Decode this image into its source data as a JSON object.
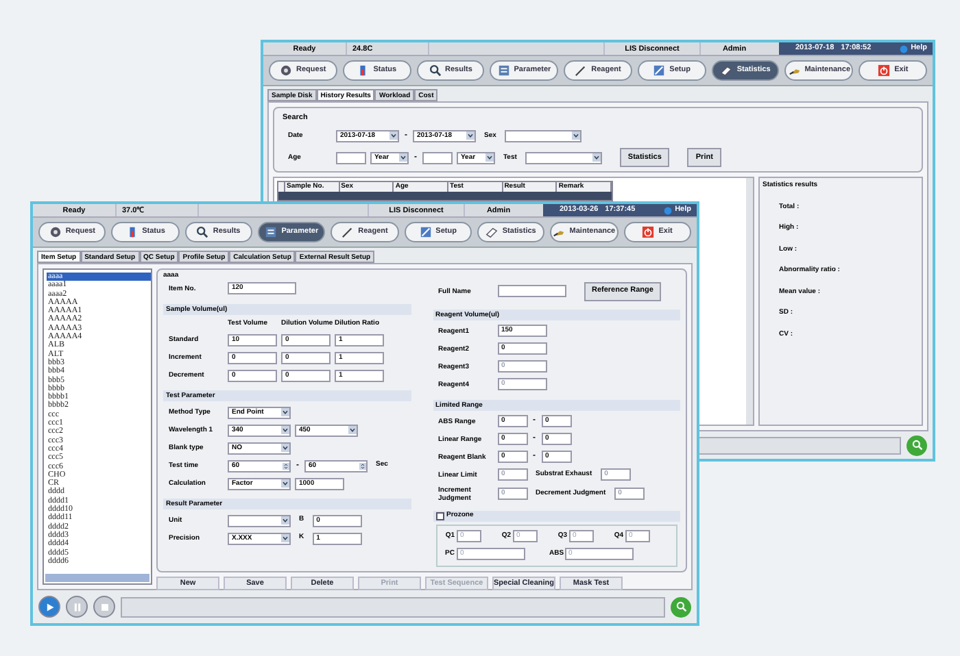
{
  "back_window": {
    "status_bar": {
      "state": "Ready",
      "temperature": "24.8C",
      "lis": "LIS Disconnect",
      "user": "Admin",
      "date": "2013-07-18",
      "time": "17:08:52",
      "help": "Help"
    },
    "toolbar": [
      {
        "label": "Request",
        "selected": false
      },
      {
        "label": "Status",
        "selected": false
      },
      {
        "label": "Results",
        "selected": false
      },
      {
        "label": "Parameter",
        "selected": false
      },
      {
        "label": "Reagent",
        "selected": false
      },
      {
        "label": "Setup",
        "selected": false
      },
      {
        "label": "Statistics",
        "selected": true
      },
      {
        "label": "Maintenance",
        "selected": false
      },
      {
        "label": "Exit",
        "selected": false
      }
    ],
    "tabs": [
      {
        "label": "Sample Disk",
        "selected": false
      },
      {
        "label": "History Results",
        "selected": true
      },
      {
        "label": "Workload",
        "selected": false
      },
      {
        "label": "Cost",
        "selected": false
      }
    ],
    "search": {
      "title": "Search",
      "rows": [
        {
          "label": "Date",
          "controls": [
            {
              "kind": "select",
              "value": "2013-07-18"
            },
            {
              "kind": "text",
              "value": "-"
            },
            {
              "kind": "select",
              "value": "2013-07-18"
            },
            {
              "kind": "label",
              "value": "Sex"
            },
            {
              "kind": "select_l"
            }
          ]
        },
        {
          "label": "Age",
          "controls": [
            {
              "kind": "input_s"
            },
            {
              "kind": "select_s",
              "value": "Year"
            },
            {
              "kind": "text",
              "value": "-"
            },
            {
              "kind": "input_s"
            },
            {
              "kind": "select_s",
              "value": "Year"
            },
            {
              "kind": "label",
              "value": "Test"
            },
            {
              "kind": "select_l"
            },
            {
              "kind": "button",
              "value": "Statistics"
            },
            {
              "kind": "button",
              "value": "Print"
            }
          ]
        }
      ]
    },
    "table": {
      "columns": [
        "Sample No.",
        "Sex",
        "Age",
        "Test",
        "Result",
        "Remark"
      ],
      "rows": [
        {
          "selected": true
        }
      ]
    },
    "statistics_results": {
      "title": "Statistics results",
      "items": [
        "Total :",
        "High :",
        "Low :",
        "Abnormality ratio :",
        "Mean value :",
        "SD :",
        "CV :"
      ]
    }
  },
  "front_window": {
    "status_bar": {
      "state": "Ready",
      "temperature": "37.0℃",
      "lis": "LIS Disconnect",
      "user": "Admin",
      "date": "2013-03-26",
      "time": "17:37:45",
      "help": "Help"
    },
    "toolbar": [
      {
        "label": "Request",
        "selected": false
      },
      {
        "label": "Status",
        "selected": false
      },
      {
        "label": "Results",
        "selected": false
      },
      {
        "label": "Parameter",
        "selected": true
      },
      {
        "label": "Reagent",
        "selected": false
      },
      {
        "label": "Setup",
        "selected": false
      },
      {
        "label": "Statistics",
        "selected": false
      },
      {
        "label": "Maintenance",
        "selected": false
      },
      {
        "label": "Exit",
        "selected": false
      }
    ],
    "tabs": [
      {
        "label": "Item Setup",
        "selected": true
      },
      {
        "label": "Standard Setup",
        "selected": false
      },
      {
        "label": "QC Setup",
        "selected": false
      },
      {
        "label": "Profile Setup",
        "selected": false
      },
      {
        "label": "Calculation Setup",
        "selected": false
      },
      {
        "label": "External Result Setup",
        "selected": false
      }
    ],
    "item_list": [
      {
        "label": "aaaa",
        "selected": true
      },
      {
        "label": "aaaa1",
        "selected": false
      },
      {
        "label": "aaaa2",
        "selected": false
      },
      {
        "label": "AAAAA",
        "selected": false
      },
      {
        "label": "AAAAA1",
        "selected": false
      },
      {
        "label": "AAAAA2",
        "selected": false
      },
      {
        "label": "AAAAA3",
        "selected": false
      },
      {
        "label": "AAAAA4",
        "selected": false
      },
      {
        "label": "ALB",
        "selected": false
      },
      {
        "label": "ALT",
        "selected": false
      },
      {
        "label": "bbb3",
        "selected": false
      },
      {
        "label": "bbb4",
        "selected": false
      },
      {
        "label": "bbb5",
        "selected": false
      },
      {
        "label": "bbbb",
        "selected": false
      },
      {
        "label": "bbbb1",
        "selected": false
      },
      {
        "label": "bbbb2",
        "selected": false
      },
      {
        "label": "ccc",
        "selected": false
      },
      {
        "label": "ccc1",
        "selected": false
      },
      {
        "label": "ccc2",
        "selected": false
      },
      {
        "label": "ccc3",
        "selected": false
      },
      {
        "label": "ccc4",
        "selected": false
      },
      {
        "label": "ccc5",
        "selected": false
      },
      {
        "label": "ccc6",
        "selected": false
      },
      {
        "label": "CHO",
        "selected": false
      },
      {
        "label": "CR",
        "selected": false
      },
      {
        "label": "dddd",
        "selected": false
      },
      {
        "label": "dddd1",
        "selected": false
      },
      {
        "label": "dddd10",
        "selected": false
      },
      {
        "label": "dddd11",
        "selected": false
      },
      {
        "label": "dddd2",
        "selected": false
      },
      {
        "label": "dddd3",
        "selected": false
      },
      {
        "label": "dddd4",
        "selected": false
      },
      {
        "label": "dddd5",
        "selected": false
      },
      {
        "label": "dddd6",
        "selected": false
      }
    ],
    "form": {
      "title": "aaaa",
      "left": [
        {
          "kind": "row",
          "label": "Item No.",
          "controls": [
            {
              "kind": "input_l",
              "value": "120"
            }
          ]
        },
        {
          "kind": "section",
          "title": "Sample Volume(ul)"
        },
        {
          "kind": "heads",
          "heads": [
            "Test Volume",
            "Dilution Volume",
            "Dilution Ratio"
          ]
        },
        {
          "kind": "row",
          "label": "Standard",
          "controls": [
            {
              "kind": "input",
              "value": "10"
            },
            {
              "kind": "input",
              "value": "0"
            },
            {
              "kind": "input",
              "value": "1"
            }
          ]
        },
        {
          "kind": "row",
          "label": "Increment",
          "controls": [
            {
              "kind": "input",
              "value": "0"
            },
            {
              "kind": "input",
              "value": "0"
            },
            {
              "kind": "input",
              "value": "1"
            }
          ]
        },
        {
          "kind": "row",
          "label": "Decrement",
          "controls": [
            {
              "kind": "input",
              "value": "0"
            },
            {
              "kind": "input",
              "value": "0"
            },
            {
              "kind": "input",
              "value": "1"
            }
          ]
        },
        {
          "kind": "section",
          "title": "Test Parameter"
        },
        {
          "kind": "row",
          "label": "Method Type",
          "controls": [
            {
              "kind": "select",
              "value": "End Point"
            }
          ]
        },
        {
          "kind": "row",
          "label": "Wavelength 1",
          "controls": [
            {
              "kind": "select",
              "value": "340"
            },
            {
              "kind": "select",
              "value": "450"
            }
          ]
        },
        {
          "kind": "row",
          "label": "Blank type",
          "controls": [
            {
              "kind": "select",
              "value": "NO"
            }
          ]
        },
        {
          "kind": "row",
          "label": "Test time",
          "controls": [
            {
              "kind": "spin",
              "value": "60"
            },
            {
              "kind": "text",
              "value": "-"
            },
            {
              "kind": "spin",
              "value": "60"
            },
            {
              "kind": "label",
              "value": "Sec"
            }
          ]
        },
        {
          "kind": "row",
          "label": "Calculation",
          "controls": [
            {
              "kind": "select",
              "value": "Factor"
            },
            {
              "kind": "input",
              "value": "1000"
            }
          ]
        },
        {
          "kind": "section",
          "title": "Result Parameter"
        },
        {
          "kind": "row",
          "label": "Unit",
          "controls": [
            {
              "kind": "select"
            },
            {
              "kind": "label",
              "value": "B"
            },
            {
              "kind": "input",
              "value": "0"
            }
          ]
        },
        {
          "kind": "row",
          "label": "Precision",
          "controls": [
            {
              "kind": "select",
              "value": "X.XXX"
            },
            {
              "kind": "label",
              "value": "K"
            },
            {
              "kind": "input",
              "value": "1"
            }
          ]
        }
      ],
      "right": [
        {
          "kind": "row",
          "label": "Full Name",
          "controls": [
            {
              "kind": "input_l"
            },
            {
              "kind": "button",
              "value": "Reference Range"
            }
          ]
        },
        {
          "kind": "section",
          "title": "Reagent Volume(ul)"
        },
        {
          "kind": "row",
          "label": "Reagent1",
          "controls": [
            {
              "kind": "input",
              "value": "150",
              "disabled": false
            }
          ]
        },
        {
          "kind": "row",
          "label": "Reagent2",
          "controls": [
            {
              "kind": "input",
              "value": "0",
              "disabled": false
            }
          ]
        },
        {
          "kind": "row",
          "label": "Reagent3",
          "controls": [
            {
              "kind": "input",
              "value": "0",
              "disabled": true
            }
          ]
        },
        {
          "kind": "row",
          "label": "Reagent4",
          "controls": [
            {
              "kind": "input",
              "value": "0",
              "disabled": true
            }
          ]
        },
        {
          "kind": "section",
          "title": "Limited Range"
        },
        {
          "kind": "row",
          "label": "ABS Range",
          "controls": [
            {
              "kind": "input_s",
              "value": "0"
            },
            {
              "kind": "text",
              "value": "-"
            },
            {
              "kind": "input_s",
              "value": "0"
            }
          ]
        },
        {
          "kind": "row",
          "label": "Linear Range",
          "controls": [
            {
              "kind": "input_s",
              "value": "0"
            },
            {
              "kind": "text",
              "value": "-"
            },
            {
              "kind": "input_s",
              "value": "0"
            }
          ]
        },
        {
          "kind": "row",
          "label": "Reagent Blank",
          "controls": [
            {
              "kind": "input_s",
              "value": "0"
            },
            {
              "kind": "text",
              "value": "-"
            },
            {
              "kind": "input_s",
              "value": "0"
            }
          ]
        },
        {
          "kind": "row",
          "label": "Linear Limit",
          "controls": [
            {
              "kind": "input_s",
              "value": "0",
              "disabled": true
            },
            {
              "kind": "label",
              "value": "Substrat Exhaust"
            },
            {
              "kind": "input_s",
              "value": "0",
              "disabled": true
            }
          ]
        },
        {
          "kind": "row",
          "label": "Increment Judgment",
          "controls": [
            {
              "kind": "input_s",
              "value": "0",
              "disabled": true
            },
            {
              "kind": "label",
              "value": "Decrement Judgment"
            },
            {
              "kind": "input_s",
              "value": "0",
              "disabled": true
            }
          ]
        },
        {
          "kind": "check_section",
          "title": "Prozone",
          "checked": false,
          "rows": [
            {
              "controls": [
                {
                  "kind": "labeled",
                  "label": "Q1",
                  "value": "0",
                  "disabled": true
                },
                {
                  "kind": "labeled",
                  "label": "Q2",
                  "value": "0",
                  "disabled": true
                },
                {
                  "kind": "labeled",
                  "label": "Q3",
                  "value": "0",
                  "disabled": true
                },
                {
                  "kind": "labeled",
                  "label": "Q4",
                  "value": "0",
                  "disabled": true
                }
              ]
            },
            {
              "controls": [
                {
                  "kind": "labeled_l",
                  "label": "PC",
                  "value": "0",
                  "disabled": true
                },
                {
                  "kind": "labeled_l",
                  "label": "ABS",
                  "value": "0",
                  "disabled": true
                }
              ]
            }
          ]
        }
      ]
    },
    "actions": [
      {
        "label": "New",
        "disabled": false
      },
      {
        "label": "Save",
        "disabled": false
      },
      {
        "label": "Delete",
        "disabled": false
      },
      {
        "label": "Print",
        "disabled": true
      },
      {
        "label": "Test Sequence",
        "disabled": true
      },
      {
        "label": "Special Cleaning",
        "disabled": false
      },
      {
        "label": "Mask Test",
        "disabled": false
      }
    ]
  }
}
